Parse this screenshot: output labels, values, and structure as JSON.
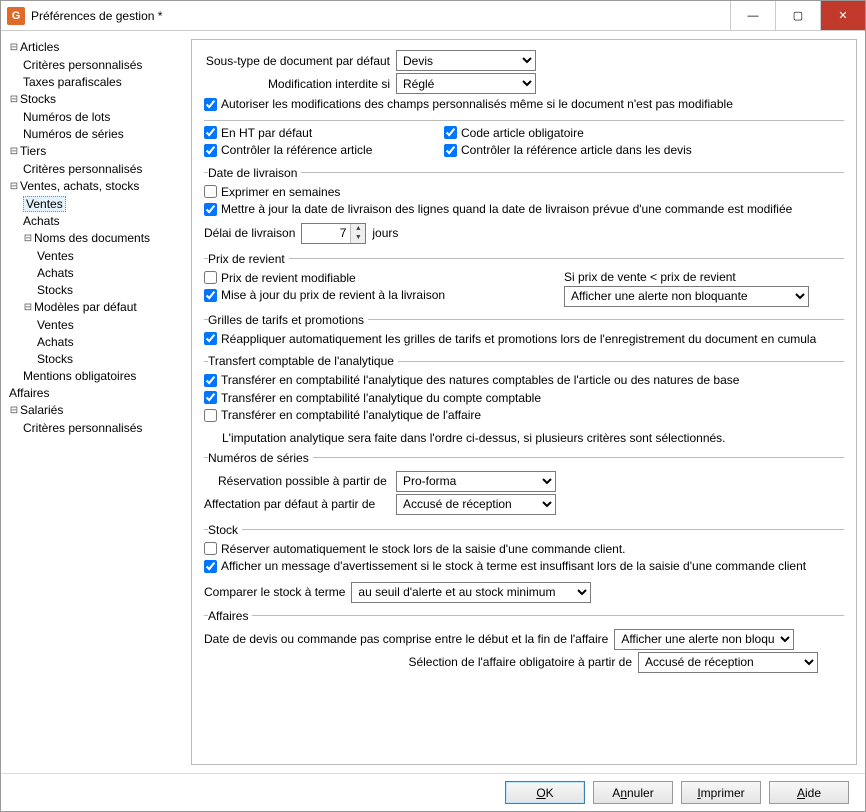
{
  "window": {
    "title": "Préférences de gestion *"
  },
  "tree": {
    "articles": "Articles",
    "articles_crit": "Critères personnalisés",
    "articles_taxes": "Taxes parafiscales",
    "stocks": "Stocks",
    "stocks_lots": "Numéros de lots",
    "stocks_series": "Numéros de séries",
    "tiers": "Tiers",
    "tiers_crit": "Critères personnalisés",
    "vas": "Ventes, achats, stocks",
    "vas_ventes": "Ventes",
    "vas_achats": "Achats",
    "noms_docs": "Noms des documents",
    "nd_ventes": "Ventes",
    "nd_achats": "Achats",
    "nd_stocks": "Stocks",
    "modeles": "Modèles par défaut",
    "md_ventes": "Ventes",
    "md_achats": "Achats",
    "md_stocks": "Stocks",
    "mentions": "Mentions obligatoires",
    "affaires": "Affaires",
    "salaries": "Salariés",
    "sal_crit": "Critères personnalisés"
  },
  "form": {
    "sous_type_label": "Sous-type de document par défaut",
    "sous_type_value": "Devis",
    "modif_interdite_label": "Modification interdite si",
    "modif_interdite_value": "Réglé",
    "autoriser_modif": "Autoriser les modifications des champs personnalisés même si le document n'est pas modifiable",
    "en_ht": "En HT par défaut",
    "code_article": "Code article obligatoire",
    "controler_ref": "Contrôler la référence article",
    "controler_ref_devis": "Contrôler la référence article dans les devis",
    "date_livraison_legend": "Date de livraison",
    "exprimer_semaines": "Exprimer en semaines",
    "mettre_a_jour_date": "Mettre à jour la date de livraison des lignes quand la date de livraison prévue d'une commande est modifiée",
    "delai_label": "Délai de livraison",
    "delai_value": "7",
    "delai_unit": "jours",
    "prix_revient_legend": "Prix de revient",
    "prix_revient_modifiable": "Prix de revient modifiable",
    "si_prix_label": "Si prix de vente < prix de revient",
    "maj_prix_revient": "Mise à jour du prix de revient à la livraison",
    "si_prix_value": "Afficher une alerte non bloquante",
    "grilles_legend": "Grilles de tarifs et promotions",
    "reappliquer": "Réappliquer automatiquement les grilles de tarifs et promotions lors de l'enregistrement du document en cumula",
    "transfert_legend": "Transfert comptable de l'analytique",
    "transf_natures": "Transférer en comptabilité l'analytique des natures comptables de l'article ou des natures de base",
    "transf_compte": "Transférer en comptabilité l'analytique du compte comptable",
    "transf_affaire": "Transférer en comptabilité l'analytique de l'affaire",
    "imputation_note": "L'imputation analytique sera faite dans l'ordre ci-dessus, si plusieurs critères sont sélectionnés.",
    "numeros_legend": "Numéros de séries",
    "reservation_label": "Réservation possible à partir de",
    "reservation_value": "Pro-forma",
    "affectation_label": "Affectation par défaut à partir de",
    "affectation_value": "Accusé de réception",
    "stock_legend": "Stock",
    "reserver_auto": "Réserver automatiquement le stock lors de la saisie d'une commande client.",
    "afficher_msg": "Afficher un message d'avertissement si le stock à terme est insuffisant lors de la saisie d'une commande client",
    "comparer_label": "Comparer le stock à terme",
    "comparer_value": "au seuil d'alerte et au stock minimum",
    "affaires_legend": "Affaires",
    "date_devis_label": "Date de devis ou commande pas comprise entre le début et la fin de l'affaire",
    "date_devis_value": "Afficher une alerte non bloquante",
    "selection_affaire_label": "Sélection de l'affaire obligatoire à partir de",
    "selection_affaire_value": "Accusé de réception"
  },
  "buttons": {
    "ok": "OK",
    "annuler": "Annuler",
    "imprimer": "Imprimer",
    "aide": "Aide"
  }
}
